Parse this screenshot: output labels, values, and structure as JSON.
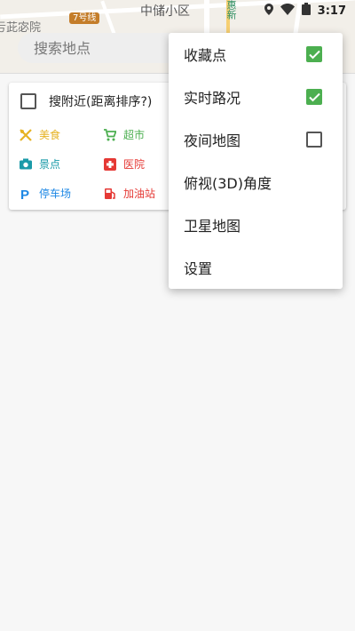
{
  "map": {
    "label_main": "中储小区",
    "label_left": "亏茈宓院",
    "label_road": "惠新",
    "metro_line": "7号线"
  },
  "status_bar": {
    "time": "3:17",
    "icons": [
      "location-icon",
      "wifi-icon",
      "battery-icon"
    ]
  },
  "search": {
    "placeholder": "搜索地点",
    "value": ""
  },
  "nearby": {
    "label": "搜附近(距离排序?)",
    "checked": false
  },
  "categories": [
    {
      "label": "美食",
      "icon": "restaurant-icon",
      "color": "#e6b323"
    },
    {
      "label": "超市",
      "icon": "cart-icon",
      "color": "#4caf50"
    },
    {
      "label": "景点",
      "icon": "camera-icon",
      "color": "#1a9aa8"
    },
    {
      "label": "医院",
      "icon": "hospital-icon",
      "color": "#e53935"
    },
    {
      "label": "停车场",
      "icon": "parking-icon",
      "color": "#1e88e5"
    },
    {
      "label": "加油站",
      "icon": "gas-station-icon",
      "color": "#e53935"
    }
  ],
  "menu": {
    "items": [
      {
        "label": "收藏点",
        "has_checkbox": true,
        "checked": true
      },
      {
        "label": "实时路况",
        "has_checkbox": true,
        "checked": true
      },
      {
        "label": "夜间地图",
        "has_checkbox": true,
        "checked": false
      },
      {
        "label": "俯视(3D)角度",
        "has_checkbox": false
      },
      {
        "label": "卫星地图",
        "has_checkbox": false
      },
      {
        "label": "设置",
        "has_checkbox": false
      }
    ],
    "check_color": "#4caf50"
  }
}
